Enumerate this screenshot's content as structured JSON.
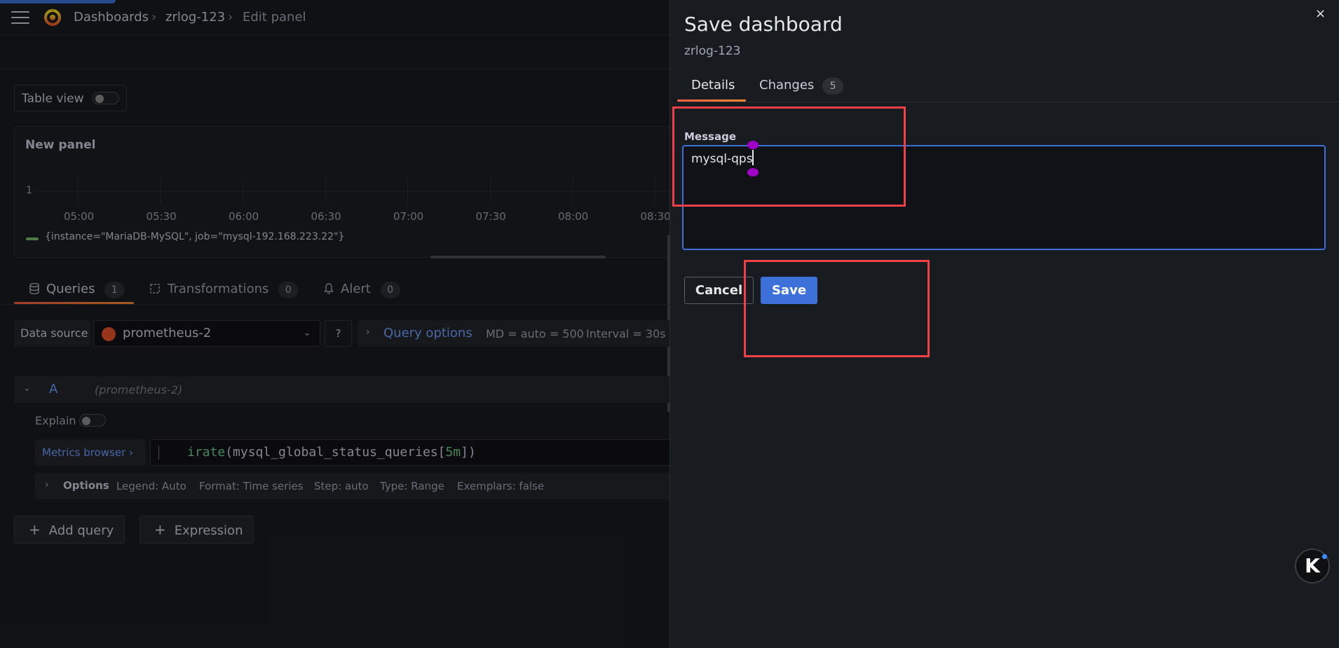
{
  "header": {
    "breadcrumbs": [
      "Dashboards",
      "zrlog-123",
      "Edit panel"
    ],
    "separator": "›"
  },
  "editor": {
    "table_view_label": "Table view",
    "panel": {
      "title": "New panel",
      "y_tick": "1",
      "x_ticks": [
        "05:00",
        "05:30",
        "06:00",
        "06:30",
        "07:00",
        "07:30",
        "08:00",
        "08:30"
      ],
      "legend": "{instance=\"MariaDB-MySQL\", job=\"mysql-192.168.223.22\"}",
      "legend_color": "#73bf69"
    },
    "tabs": [
      {
        "label": "Queries",
        "count": "1",
        "icon": "database-icon"
      },
      {
        "label": "Transformations",
        "count": "0",
        "icon": "transform-icon"
      },
      {
        "label": "Alert",
        "count": "0",
        "icon": "bell-icon"
      }
    ],
    "datasource": {
      "label": "Data source",
      "value": "prometheus-2",
      "help": "?"
    },
    "query_options": {
      "title": "Query options",
      "md": "MD = auto = 500",
      "interval": "Interval = 30s"
    },
    "query": {
      "ref": "A",
      "datasource": "(prometheus-2)",
      "explain_label": "Explain",
      "metrics_browser": "Metrics browser ›",
      "expr_fn": "irate",
      "expr_open": "(mysql_global_status_queries[",
      "expr_range": "5m",
      "expr_close": "])"
    },
    "options_row": {
      "title": "Options",
      "legend": "Legend: Auto",
      "format": "Format: Time series",
      "step": "Step: auto",
      "type": "Type: Range",
      "exemplars": "Exemplars: false"
    },
    "add_query": "Add query",
    "expression": "Expression"
  },
  "drawer": {
    "title": "Save dashboard",
    "subtitle": "zrlog-123",
    "close": "×",
    "tabs": [
      {
        "label": "Details"
      },
      {
        "label": "Changes",
        "count": "5"
      }
    ],
    "message_label": "Message",
    "message_value": "mysql-qps",
    "cancel_label": "Cancel",
    "save_label": "Save",
    "assistant_badge": "K"
  },
  "colors": {
    "accent": "#3d71d9",
    "tab_underline": "#ff8833",
    "annotation_box": "#f03f46",
    "selection_handle": "#a100c7"
  }
}
